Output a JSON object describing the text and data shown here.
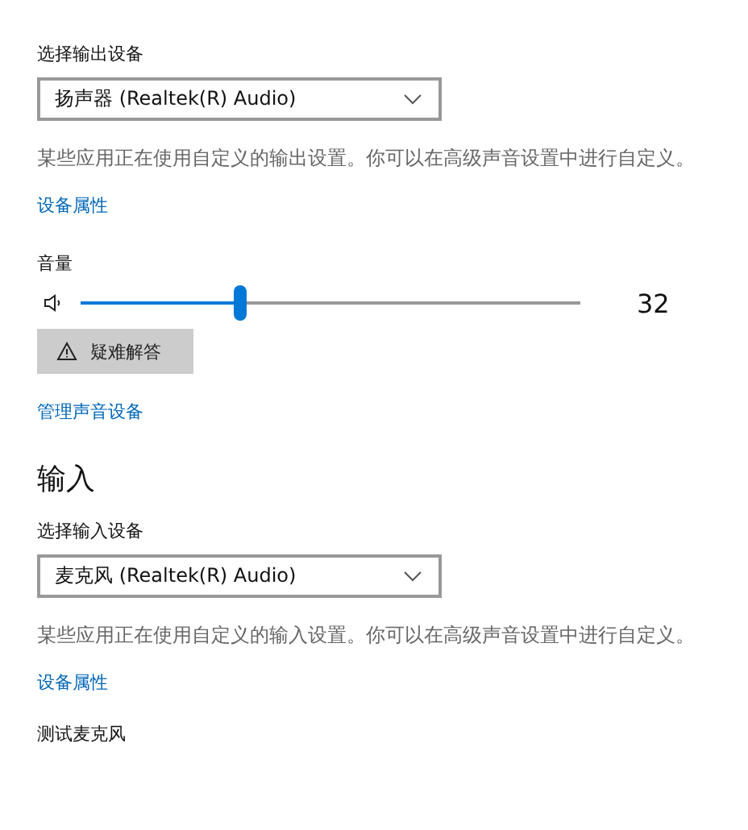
{
  "output": {
    "device_label": "选择输出设备",
    "device": {
      "value": "扬声器 (Realtek(R) Audio)"
    },
    "note": "某些应用正在使用自定义的输出设置。你可以在高级声音设置中进行自定义。",
    "properties_link": "设备属性",
    "volume_label": "音量",
    "volume": {
      "level": 0.32,
      "reading": "32"
    },
    "troubleshoot_button": "疑难解答",
    "manage_link": "管理声音设备"
  },
  "input": {
    "heading": "输入",
    "device_label": "选择输入设备",
    "device": {
      "value": "麦克风 (Realtek(R) Audio)"
    },
    "note": "某些应用正在使用自定义的输入设置。你可以在高级声音设置中进行自定义。",
    "properties_link": "设备属性",
    "test_label": "测试麦克风"
  }
}
